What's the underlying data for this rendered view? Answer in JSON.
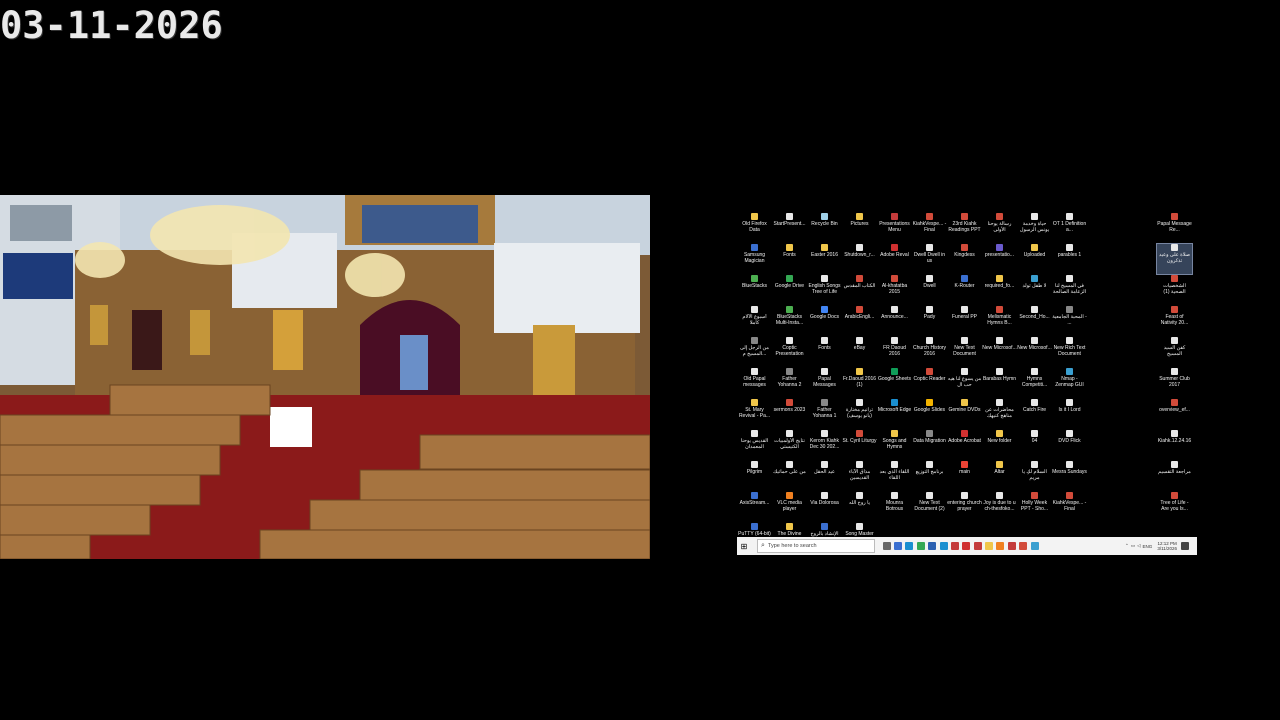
{
  "overlay": {
    "date": "03-11-2026"
  },
  "desktop": {
    "icons": [
      {
        "label": "Old Firefox Data",
        "color": "#f0c64a",
        "selected": false
      },
      {
        "label": "StartPresent...",
        "color": "#e8e8e8",
        "selected": false
      },
      {
        "label": "Recycle Bin",
        "color": "#9fd0e8",
        "selected": false
      },
      {
        "label": "Pictures",
        "color": "#f0c64a",
        "selected": false
      },
      {
        "label": "Presentations Menu",
        "color": "#c43b3b",
        "selected": false
      },
      {
        "label": "KiahkVespe... - Final",
        "color": "#d24b3a",
        "selected": false
      },
      {
        "label": "23rd Kiahk Readings PPT",
        "color": "#d24b3a",
        "selected": false
      },
      {
        "label": "رسالة يوحنا الأولى",
        "color": "#d24b3a",
        "selected": false
      },
      {
        "label": "حياة وخدمة يونس الرسول",
        "color": "#e8e8e8",
        "selected": false
      },
      {
        "label": "OT 1 Definition a...",
        "color": "#e8e8e8",
        "selected": false
      },
      {
        "label": "Papal Message Re...",
        "color": "#d24b3a",
        "selected": false
      },
      {
        "label": "Samsung Magician",
        "color": "#3a6fd0",
        "selected": false
      },
      {
        "label": "Fonts",
        "color": "#f0c64a",
        "selected": false
      },
      {
        "label": "Easter 2016",
        "color": "#f0c64a",
        "selected": false
      },
      {
        "label": "Shutdown_r...",
        "color": "#e8e8e8",
        "selected": false
      },
      {
        "label": "Adobe Reval",
        "color": "#d03030",
        "selected": false
      },
      {
        "label": "Dwell Dwell in us",
        "color": "#e8e8e8",
        "selected": false
      },
      {
        "label": "Kingdess",
        "color": "#d24b3a",
        "selected": false
      },
      {
        "label": "presentatio...",
        "color": "#6a5acd",
        "selected": false
      },
      {
        "label": "Uploaded",
        "color": "#f0c64a",
        "selected": false
      },
      {
        "label": "parables 1",
        "color": "#e8e8e8",
        "selected": false
      },
      {
        "label": "صلاة على وعيد تذكرون",
        "color": "#e8e8e8",
        "selected": true
      },
      {
        "label": "BlueStacks",
        "color": "#4caf50",
        "selected": false
      },
      {
        "label": "Google Drive",
        "color": "#34a853",
        "selected": false
      },
      {
        "label": "English Songs Tree of Life",
        "color": "#e8e8e8",
        "selected": false
      },
      {
        "label": "الكتاب المقدس",
        "color": "#d24b3a",
        "selected": false
      },
      {
        "label": "Al-khatatba 2015",
        "color": "#d24b3a",
        "selected": false
      },
      {
        "label": "Dwell",
        "color": "#e8e8e8",
        "selected": false
      },
      {
        "label": "K-Router",
        "color": "#3a6fd0",
        "selected": false
      },
      {
        "label": "required_fo...",
        "color": "#f0c64a",
        "selected": false
      },
      {
        "label": "لا طفل تولد",
        "color": "#3a9fd0",
        "selected": false
      },
      {
        "label": "في المسيح لنا الزعامة الصالحة",
        "color": "#e8e8e8",
        "selected": false
      },
      {
        "label": "الشخصيات الصحية (1)",
        "color": "#d24b3a",
        "selected": false
      },
      {
        "label": "أسبوع الآلام كاملا",
        "color": "#e8e8e8",
        "selected": false
      },
      {
        "label": "BlueStacks Multi-Insta...",
        "color": "#4caf50",
        "selected": false
      },
      {
        "label": "Google Docs",
        "color": "#4285f4",
        "selected": false
      },
      {
        "label": "ArabicEngli...",
        "color": "#d24b3a",
        "selected": false
      },
      {
        "label": "Announce...",
        "color": "#e8e8e8",
        "selected": false
      },
      {
        "label": "Pady",
        "color": "#e8e8e8",
        "selected": false
      },
      {
        "label": "Funeral PP",
        "color": "#e8e8e8",
        "selected": false
      },
      {
        "label": "Melismatic Hymns B...",
        "color": "#d24b3a",
        "selected": false
      },
      {
        "label": "Second_Ho...",
        "color": "#e8e8e8",
        "selected": false
      },
      {
        "label": "المحبة الجامعية - ...",
        "color": "#888888",
        "selected": false
      },
      {
        "label": "Feast of Nativity 20...",
        "color": "#d24b3a",
        "selected": false
      },
      {
        "label": "من الرجل إلى المسيح م...",
        "color": "#888888",
        "selected": false
      },
      {
        "label": "Coptic Presentation",
        "color": "#e8e8e8",
        "selected": false
      },
      {
        "label": "Fonts",
        "color": "#e8e8e8",
        "selected": false
      },
      {
        "label": "eBay",
        "color": "#e8e8e8",
        "selected": false
      },
      {
        "label": "FR Daoud 2016",
        "color": "#e8e8e8",
        "selected": false
      },
      {
        "label": "Church History 2016",
        "color": "#e8e8e8",
        "selected": false
      },
      {
        "label": "New Text Document",
        "color": "#e8e8e8",
        "selected": false
      },
      {
        "label": "New Microsof...",
        "color": "#e8e8e8",
        "selected": false
      },
      {
        "label": "New Microsof...",
        "color": "#e8e8e8",
        "selected": false
      },
      {
        "label": "New Rich Text Document",
        "color": "#e8e8e8",
        "selected": false
      },
      {
        "label": "كفن السيد المسيح",
        "color": "#e8e8e8",
        "selected": false
      },
      {
        "label": "Old Papal messages",
        "color": "#e8e8e8",
        "selected": false
      },
      {
        "label": "Father Yohanna 2",
        "color": "#888888",
        "selected": false
      },
      {
        "label": "Papal Messages",
        "color": "#e8e8e8",
        "selected": false
      },
      {
        "label": "Fr.Daoud 2016 (1)",
        "color": "#f0c64a",
        "selected": false
      },
      {
        "label": "Google Sheets",
        "color": "#0f9d58",
        "selected": false
      },
      {
        "label": "Coptic Reader",
        "color": "#d24b3a",
        "selected": false
      },
      {
        "label": "من يسوع لنا هيه حب ال",
        "color": "#e8e8e8",
        "selected": false
      },
      {
        "label": "Barabas Hymn",
        "color": "#e8e8e8",
        "selected": false
      },
      {
        "label": "Hymns Competiti...",
        "color": "#e8e8e8",
        "selected": false
      },
      {
        "label": "Nmap - Zenmap GUI",
        "color": "#3a9fd0",
        "selected": false
      },
      {
        "label": "Summer Club 2017",
        "color": "#e8e8e8",
        "selected": false
      },
      {
        "label": "St. Mary Revival - Pa...",
        "color": "#f0c64a",
        "selected": false
      },
      {
        "label": "sermons 2023",
        "color": "#d24b3a",
        "selected": false
      },
      {
        "label": "Father Yohanna 1",
        "color": "#888888",
        "selected": false
      },
      {
        "label": "ترانيم مختارة (بانو يوسف)",
        "color": "#e8e8e8",
        "selected": false
      },
      {
        "label": "Microsoft Edge",
        "color": "#1a8fd0",
        "selected": false
      },
      {
        "label": "Google Slides",
        "color": "#f4b400",
        "selected": false
      },
      {
        "label": "Gemine DVDs",
        "color": "#f0c64a",
        "selected": false
      },
      {
        "label": "محاضرات عن مناهج كنيهك",
        "color": "#e8e8e8",
        "selected": false
      },
      {
        "label": "Catch Fire",
        "color": "#e8e8e8",
        "selected": false
      },
      {
        "label": "Is it I Lord",
        "color": "#e8e8e8",
        "selected": false
      },
      {
        "label": "overview_ef...",
        "color": "#d24b3a",
        "selected": false
      },
      {
        "label": "القديس يوحنا المعمدان",
        "color": "#e8e8e8",
        "selected": false
      },
      {
        "label": "نتايج الأولمبيات الكنيستي",
        "color": "#e8e8e8",
        "selected": false
      },
      {
        "label": "Kerorn Kiahk Dec 30 202...",
        "color": "#e8e8e8",
        "selected": false
      },
      {
        "label": "St. Cyril Liturgy",
        "color": "#d24b3a",
        "selected": false
      },
      {
        "label": "Songs and Hymns",
        "color": "#f0c64a",
        "selected": false
      },
      {
        "label": "Data Migration",
        "color": "#888888",
        "selected": false
      },
      {
        "label": "Adobe Acrobat",
        "color": "#d03030",
        "selected": false
      },
      {
        "label": "New folder",
        "color": "#f0c64a",
        "selected": false
      },
      {
        "label": "04",
        "color": "#e8e8e8",
        "selected": false
      },
      {
        "label": "DVD Flick",
        "color": "#e8e8e8",
        "selected": false
      },
      {
        "label": "Kiahk.12.24.16",
        "color": "#e8e8e8",
        "selected": false
      },
      {
        "label": "Pilgrim",
        "color": "#e8e8e8",
        "selected": false
      },
      {
        "label": "من على حماتيك",
        "color": "#e8e8e8",
        "selected": false
      },
      {
        "label": "عيد الحقل",
        "color": "#e8e8e8",
        "selected": false
      },
      {
        "label": "مذاق الآباء القديسين",
        "color": "#e8e8e8",
        "selected": false
      },
      {
        "label": "اللقاء الذي بعد اللقاء",
        "color": "#e8e8e8",
        "selected": false
      },
      {
        "label": "برنامج التوزيع",
        "color": "#e8e8e8",
        "selected": false
      },
      {
        "label": "main",
        "color": "#ea4335",
        "selected": false
      },
      {
        "label": "Altar",
        "color": "#f0c64a",
        "selected": false
      },
      {
        "label": "السلام لكِ يا مريم",
        "color": "#e8e8e8",
        "selected": false
      },
      {
        "label": "Mesra Sundays",
        "color": "#e8e8e8",
        "selected": false
      },
      {
        "label": "مراجعة التقسيم",
        "color": "#e8e8e8",
        "selected": false
      },
      {
        "label": "AxisStream...",
        "color": "#3a6fd0",
        "selected": false
      },
      {
        "label": "VLC media player",
        "color": "#f08020",
        "selected": false
      },
      {
        "label": "Via Dolorosa",
        "color": "#e8e8e8",
        "selected": false
      },
      {
        "label": "يا روح الله",
        "color": "#e8e8e8",
        "selected": false
      },
      {
        "label": "Mounra Botrous",
        "color": "#e8e8e8",
        "selected": false
      },
      {
        "label": "New Text Document (2)",
        "color": "#e8e8e8",
        "selected": false
      },
      {
        "label": "entering church prayer",
        "color": "#e8e8e8",
        "selected": false
      },
      {
        "label": "Joy is due to u ch-thesfoko...",
        "color": "#e8e8e8",
        "selected": false
      },
      {
        "label": "Holly Week PPT - Sho...",
        "color": "#d24b3a",
        "selected": false
      },
      {
        "label": "KiahkVespe... - Final",
        "color": "#d24b3a",
        "selected": false
      },
      {
        "label": "Tree of Life - Are you Is...",
        "color": "#d24b3a",
        "selected": false
      },
      {
        "label": "PuTTY (64-bit)",
        "color": "#3a6fd0",
        "selected": false
      },
      {
        "label": "The Divine Liturgy",
        "color": "#f0c64a",
        "selected": false
      },
      {
        "label": "الإنشاد بالروح القدس",
        "color": "#3a6fd0",
        "selected": false
      },
      {
        "label": "Song Master List (1)",
        "color": "#e8e8e8",
        "selected": false
      }
    ]
  },
  "taskbar": {
    "search_placeholder": "Type here to search",
    "time": "12:12 PM",
    "date": "3/11/2026",
    "lang": "ENG",
    "pinned": [
      "#666666",
      "#3a6fd0",
      "#1a8fd0",
      "#34a853",
      "#2a5fb0",
      "#1a8fd0",
      "#c43b3b",
      "#d03030",
      "#c43b3b",
      "#f0c64a",
      "#f08020",
      "#c43b3b",
      "#d24b3a",
      "#3a9fd0"
    ]
  }
}
